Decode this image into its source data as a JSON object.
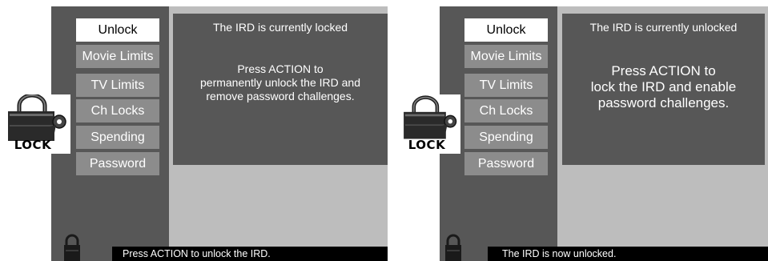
{
  "screens": [
    {
      "menu": [
        "Unlock",
        "Movie Limits",
        "TV Limits",
        "Ch Locks",
        "Spending",
        "Password"
      ],
      "selected_index": 0,
      "status": "The IRD is currently locked",
      "message": "Press ACTION to\npermanently unlock the IRD and\nremove password challenges.",
      "footer": "Press ACTION to unlock the IRD.",
      "lock_label": "LOCK"
    },
    {
      "menu": [
        "Unlock",
        "Movie Limits",
        "TV Limits",
        "Ch Locks",
        "Spending",
        "Password"
      ],
      "selected_index": 0,
      "status": "The IRD is currently unlocked",
      "message": "Press ACTION to\nlock the IRD and enable\npassword challenges.",
      "footer": "The IRD is now unlocked.",
      "lock_label": "LOCK"
    }
  ],
  "colors": {
    "panel_bg": "#bdbdbd",
    "menu_bg": "#575757",
    "menu_item": "#8c8c8c",
    "menu_selected": "#ffffff",
    "status_bar": "#000000"
  },
  "icons": [
    "padlock-key-icon",
    "small-padlock-icon"
  ]
}
